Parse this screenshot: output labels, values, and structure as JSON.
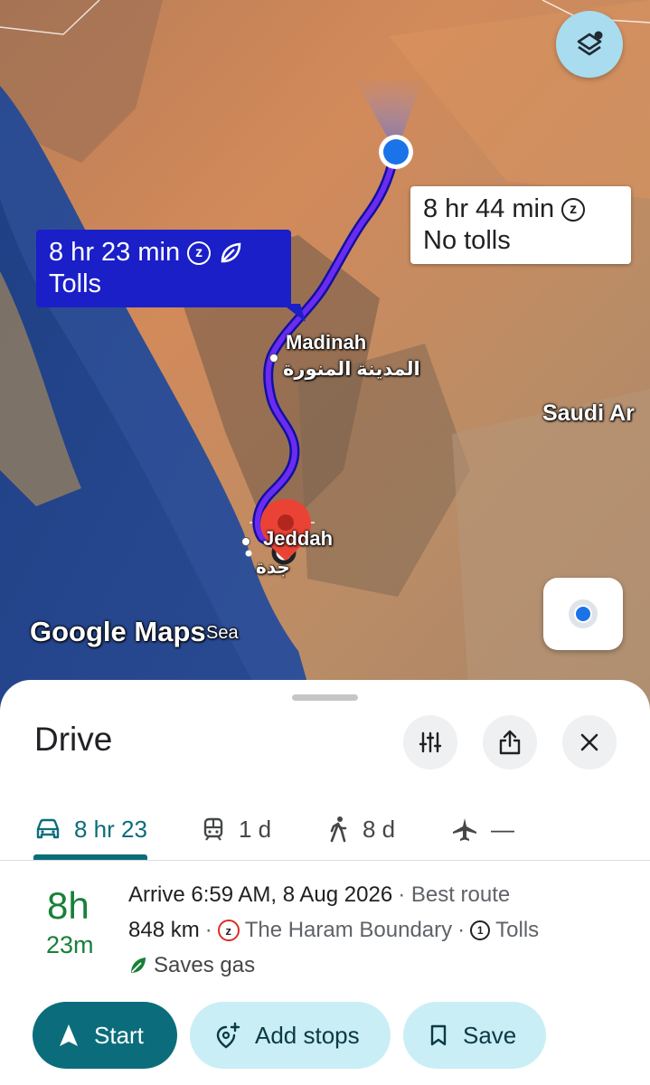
{
  "map": {
    "layers_icon": "layers-icon",
    "route_primary": {
      "duration": "8 hr 23 min",
      "note": "Tolls",
      "color": "#1a1fc8"
    },
    "route_alternate": {
      "duration": "8 hr 44 min",
      "note": "No tolls"
    },
    "labels": {
      "madinah": "Madinah",
      "madinah_ar": "المدينة المنورة",
      "saudi": "Saudi Ar",
      "jeddah": "Jeddah",
      "jeddah_ar": "جدة",
      "watermark": "Google Maps",
      "sea": "Sea"
    },
    "my_location_icon": "my-location-icon"
  },
  "sheet": {
    "title": "Drive",
    "modes": [
      {
        "name": "drive",
        "icon": "car-icon",
        "label": "8 hr 23"
      },
      {
        "name": "transit",
        "icon": "train-icon",
        "label": "1 d"
      },
      {
        "name": "walk",
        "icon": "walk-icon",
        "label": "8 d"
      },
      {
        "name": "flight",
        "icon": "plane-icon",
        "label": "—"
      }
    ],
    "route": {
      "hours": "8h",
      "minutes": "23m",
      "arrive": "Arrive 6:59 AM, 8 Aug 2026",
      "best": "· Best route",
      "distance": "848 km",
      "sep1": "·",
      "restriction": "The Haram Boundary",
      "sep2": "·",
      "tolls": "Tolls",
      "saves": "Saves gas"
    },
    "buttons": {
      "start": "Start",
      "add_stops": "Add stops",
      "save": "Save"
    }
  },
  "colors": {
    "accent": "#0b6d7b",
    "duration_green": "#188038",
    "pill_light": "#c9eef6",
    "route_blue": "#1a1fc8"
  }
}
